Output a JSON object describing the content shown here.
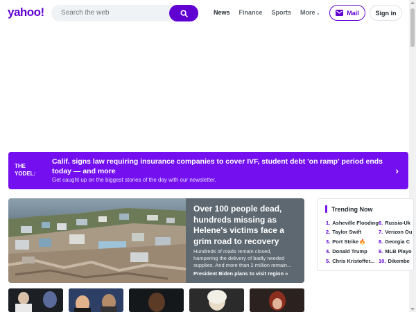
{
  "header": {
    "logo": "yahoo!",
    "search_placeholder": "Search the web",
    "nav": [
      "News",
      "Finance",
      "Sports",
      "More"
    ],
    "mail_label": "Mail",
    "signin_label": "Sign in"
  },
  "yodel": {
    "label_line1": "THE",
    "label_line2": "YODEL:",
    "title": "Calif. signs law requiring insurance companies to cover IVF, student debt 'on ramp' period ends today — and more",
    "subtitle": "Get caught up on the biggest stories of the day with our newsletter."
  },
  "hero": {
    "title": "Over 100 people dead, hundreds missing as Helene's victims face a grim road to recovery",
    "description": "Hundreds of roads remain closed, hampering the delivery of badly needed supplies. And more than 2 million remain...",
    "link": "President Biden plans to visit region »"
  },
  "trending": {
    "title": "Trending Now",
    "items": [
      {
        "num": "1.",
        "label": "Asheville Flooding"
      },
      {
        "num": "2.",
        "label": "Taylor Swift"
      },
      {
        "num": "3.",
        "label": "Port Strike"
      },
      {
        "num": "4.",
        "label": "Donald Trump"
      },
      {
        "num": "5.",
        "label": "Chris Kristoffer..."
      },
      {
        "num": "6.",
        "label": "Russia-Uk"
      },
      {
        "num": "7.",
        "label": "Verizon Ou"
      },
      {
        "num": "8.",
        "label": "Georgia C"
      },
      {
        "num": "9.",
        "label": "MLB Playo"
      },
      {
        "num": "10.",
        "label": "Dikembe"
      }
    ]
  },
  "colors": {
    "brand": "#6001d2",
    "yodel_bg": "#7410f0"
  },
  "icons": {
    "search": "search-icon",
    "mail": "mail-icon",
    "arrow": "chevron-right-icon",
    "fire": "fire-icon"
  }
}
